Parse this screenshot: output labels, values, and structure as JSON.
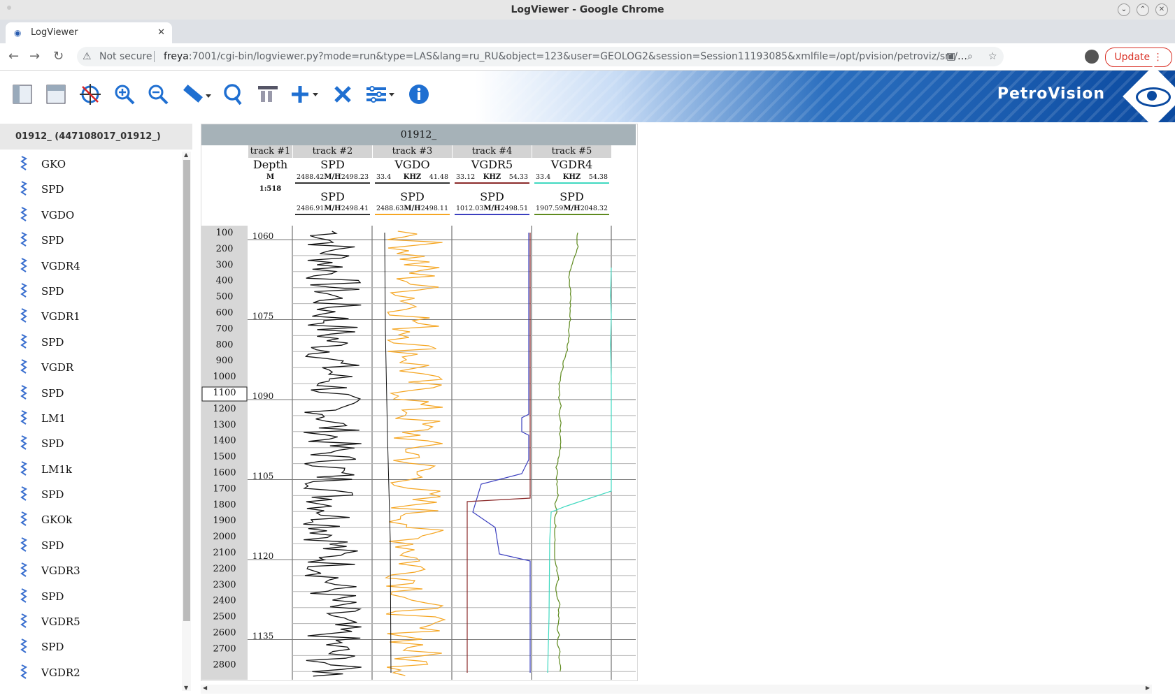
{
  "window": {
    "title": "LogViewer - Google Chrome"
  },
  "tab": {
    "label": "LogViewer"
  },
  "address": {
    "security_label": "Not secure",
    "url_host": "freya",
    "url_rest": ":7001/cgi-bin/logviewer.py?mode=run&type=LAS&lang=ru_RU&object=123&user=GEOLOG2&session=Session11193085&xmlfile=/opt/pvision/petroviz/src/pvou...",
    "update_label": "Update"
  },
  "brand": {
    "name": "PetroVision"
  },
  "toolbar": {
    "icons": [
      "panel-left-icon",
      "panel-top-icon",
      "target-icon",
      "zoom-in-icon",
      "zoom-out-icon",
      "ruler-icon",
      "search-icon",
      "format-icon",
      "add-icon",
      "delete-icon",
      "settings-icon",
      "info-icon"
    ]
  },
  "left_panel": {
    "header": "01912_ (447108017_01912_)",
    "curves": [
      "GKO",
      "SPD",
      "VGDO",
      "SPD",
      "VGDR4",
      "SPD",
      "VGDR1",
      "SPD",
      "VGDR",
      "SPD",
      "LM1",
      "SPD",
      "LM1k",
      "SPD",
      "GKOk",
      "SPD",
      "VGDR3",
      "SPD",
      "VGDR5",
      "SPD",
      "VGDR2"
    ]
  },
  "log": {
    "title": "01912_",
    "depth_track": {
      "track": "track #1",
      "name": "Depth",
      "unit": "M",
      "scale": "1:518"
    },
    "tracks": [
      {
        "track": "track #2",
        "top": {
          "name": "SPD",
          "min": "2488.42",
          "unit": "M/H",
          "max": "2498.23"
        },
        "bottom": {
          "name": "SPD",
          "min": "2486.91",
          "unit": "M/H",
          "max": "2498.41"
        }
      },
      {
        "track": "track #3",
        "top": {
          "name": "VGDO",
          "min": "33.4",
          "unit": "KHZ",
          "max": "41.48"
        },
        "bottom": {
          "name": "SPD",
          "min": "2488.63",
          "unit": "M/H",
          "max": "2498.11"
        }
      },
      {
        "track": "track #4",
        "top": {
          "name": "VGDR5",
          "min": "33.12",
          "unit": "KHZ",
          "max": "54.33"
        },
        "bottom": {
          "name": "SPD",
          "min": "1012.03",
          "unit": "M/H",
          "max": "2498.51"
        }
      },
      {
        "track": "track #5",
        "top": {
          "name": "VGDR4",
          "min": "33.4",
          "unit": "KHZ",
          "max": "54.38"
        },
        "bottom": {
          "name": "SPD",
          "min": "1907.59",
          "unit": "M/H",
          "max": "2048.32"
        }
      }
    ],
    "colors": {
      "black": "#111111",
      "orange": "#f5a623",
      "blue": "#3b3fbf",
      "brown": "#8b2a2a",
      "green": "#5e8a1e",
      "cyan": "#40d9c0"
    },
    "row_numbers": [
      "100",
      "200",
      "300",
      "400",
      "500",
      "600",
      "700",
      "800",
      "900",
      "1000",
      "1100",
      "1200",
      "1300",
      "1400",
      "1500",
      "1600",
      "1700",
      "1800",
      "1900",
      "2000",
      "2100",
      "2200",
      "2300",
      "2400",
      "2500",
      "2600",
      "2700",
      "2800"
    ],
    "selected_row": "1100",
    "depth_labels": [
      "1060",
      "1075",
      "1090",
      "1105",
      "1120",
      "1135"
    ]
  }
}
